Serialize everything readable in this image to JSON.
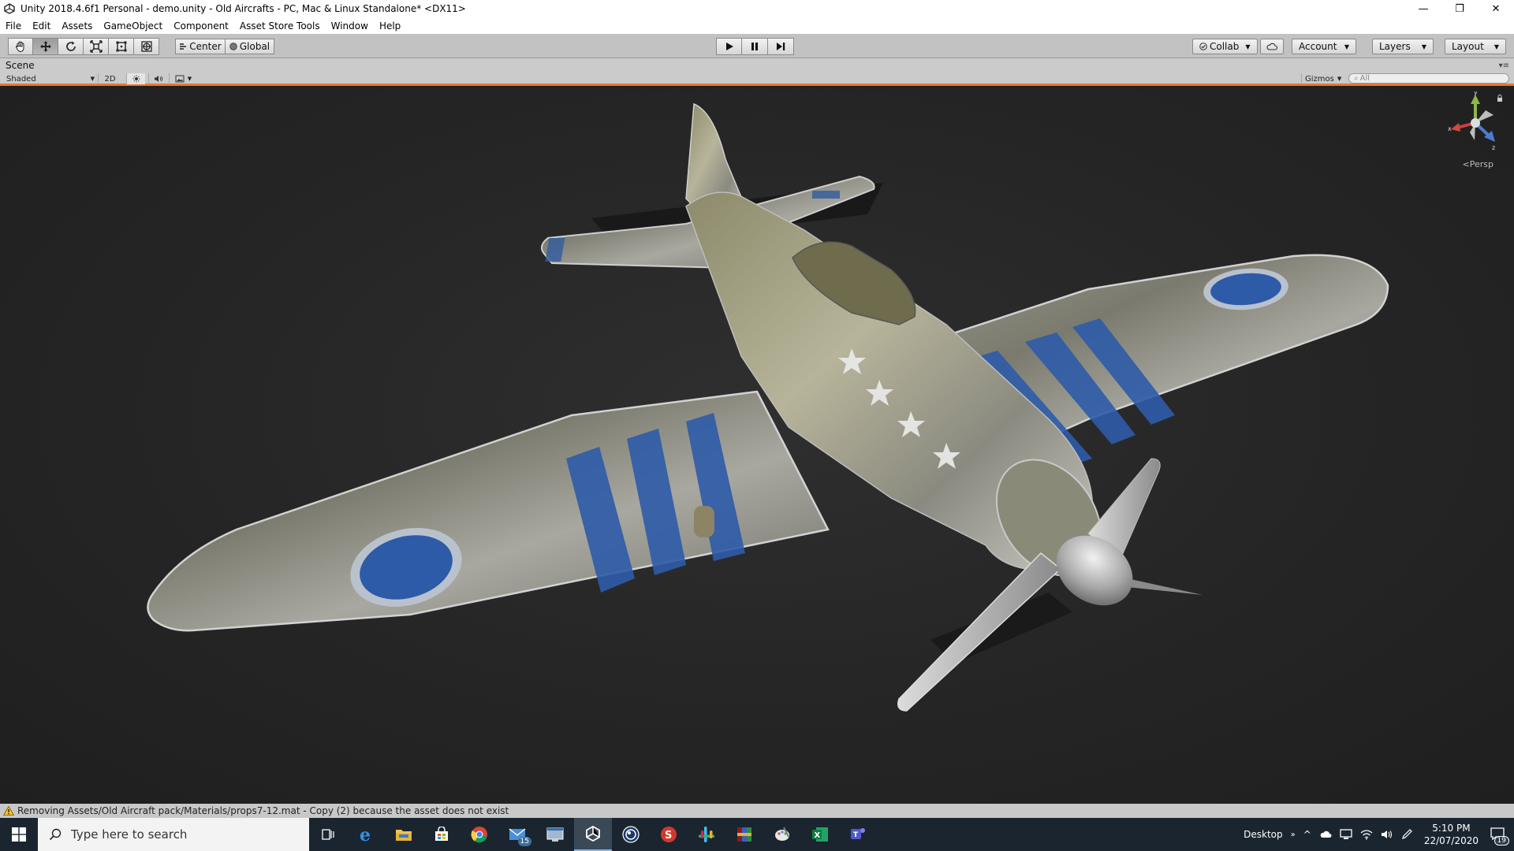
{
  "window": {
    "title": "Unity 2018.4.6f1 Personal - demo.unity - Old Aircrafts - PC, Mac & Linux Standalone* <DX11>",
    "minimize": "—",
    "restore": "❐",
    "close": "✕"
  },
  "menu": [
    "File",
    "Edit",
    "Assets",
    "GameObject",
    "Component",
    "Asset Store Tools",
    "Window",
    "Help"
  ],
  "toolbar": {
    "tools": [
      {
        "name": "hand-tool-icon"
      },
      {
        "name": "move-tool-icon"
      },
      {
        "name": "rotate-tool-icon"
      },
      {
        "name": "scale-tool-icon"
      },
      {
        "name": "rect-tool-icon"
      },
      {
        "name": "transform-tool-icon"
      }
    ],
    "pivot": "Center",
    "space": "Global",
    "collab": "Collab",
    "account": "Account",
    "layers": "Layers",
    "layout": "Layout"
  },
  "scene": {
    "tab_label": "Scene",
    "shading_mode": "Shaded",
    "mode_2d": "2D",
    "gizmos": "Gizmos",
    "search_placeholder": "All",
    "projection": "Persp",
    "axis_x": "x",
    "axis_y": "y",
    "axis_z": "z",
    "colors": {
      "highlight_border": "#e9772c",
      "background": "#262626"
    }
  },
  "status": {
    "message": "Removing Assets/Old Aircraft pack/Materials/props7-12.mat - Copy (2) because the asset does not exist"
  },
  "taskbar": {
    "search_placeholder": "Type here to search",
    "apps": [
      {
        "name": "task-view-icon"
      },
      {
        "name": "edge-icon"
      },
      {
        "name": "file-explorer-icon"
      },
      {
        "name": "store-icon"
      },
      {
        "name": "chrome-icon"
      },
      {
        "name": "mail-icon",
        "badge": "15"
      },
      {
        "name": "app-window-icon"
      },
      {
        "name": "unity-icon",
        "active": true
      },
      {
        "name": "cinema4d-icon"
      },
      {
        "name": "substance-icon"
      },
      {
        "name": "slack-icon"
      },
      {
        "name": "winrar-icon"
      },
      {
        "name": "paint-icon"
      },
      {
        "name": "excel-icon"
      },
      {
        "name": "teams-icon"
      }
    ],
    "desktop_label": "Desktop",
    "time": "5:10 PM",
    "date": "22/07/2020",
    "notifications": "19"
  }
}
